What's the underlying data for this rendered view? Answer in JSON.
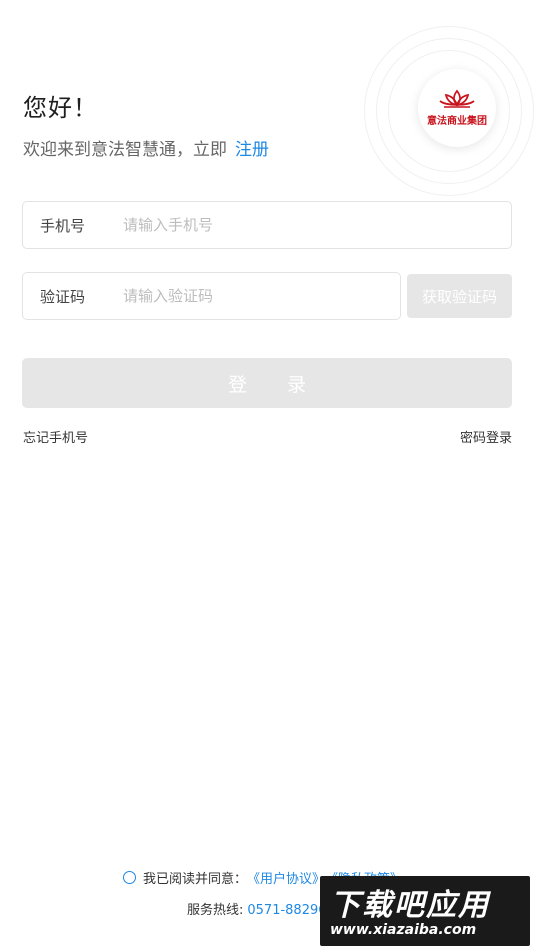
{
  "header": {
    "greeting": "您好！",
    "subtitle": "欢迎来到意法智慧通，立即",
    "register_link": "注册"
  },
  "logo": {
    "icon": "lotus-logo-icon",
    "text": "意法商业集团",
    "brand_color": "#c8141d"
  },
  "phone_field": {
    "label": "手机号",
    "placeholder": "请输入手机号",
    "value": ""
  },
  "code_field": {
    "label": "验证码",
    "placeholder": "请输入验证码",
    "value": "",
    "get_code_label": "获取验证码"
  },
  "login_button": "登录",
  "links": {
    "forgot_phone": "忘记手机号",
    "password_login": "密码登录"
  },
  "agreement": {
    "text": "我已阅读并同意：",
    "user_agreement": "《用户协议》",
    "privacy_policy": "《隐私政策》"
  },
  "hotline": {
    "label": "服务热线:",
    "number": "0571-88296885"
  },
  "watermark": {
    "main": "下载吧应用",
    "sub": "www.xiazaiba.com"
  },
  "colors": {
    "accent": "#1e88e5",
    "disabled": "#e6e6e6"
  }
}
